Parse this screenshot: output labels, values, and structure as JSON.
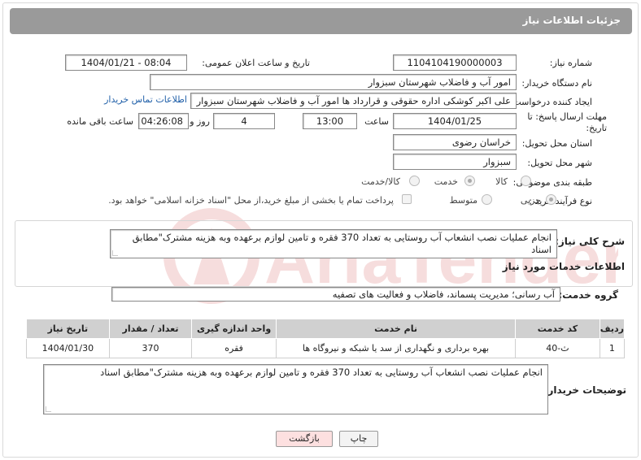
{
  "header": {
    "title": "جزئیات اطلاعات نیاز"
  },
  "form": {
    "need_number": {
      "label": "شماره نیاز:",
      "value": "1104104190000003"
    },
    "announce_datetime": {
      "label": "تاریخ و ساعت اعلان عمومی:",
      "value": "1404/01/21 - 08:04"
    },
    "buyer_org": {
      "label": "نام دستگاه خریدار:",
      "value": "امور آب و فاضلاب شهرستان سبزوار"
    },
    "requester": {
      "label": "ایجاد کننده درخواست:",
      "value": "علی اکبر کوشکی اداره حقوقی و قرارداد ها امور آب و فاضلاب شهرستان سبزوار",
      "contact_link": "اطلاعات تماس خریدار"
    },
    "deadline": {
      "label_line1": "مهلت ارسال پاسخ: تا",
      "label_line2": "تاریخ:",
      "date": "1404/01/25",
      "time_label": "ساعت",
      "time": "13:00",
      "days": "4",
      "days_label": "روز و",
      "remaining": "04:26:08",
      "remaining_label": "ساعت باقی مانده"
    },
    "province": {
      "label": "استان محل تحویل:",
      "value": "خراسان رضوی"
    },
    "city": {
      "label": "شهر محل تحویل:",
      "value": "سبزوار"
    },
    "category": {
      "label": "طبقه بندی موضوعی:",
      "options": [
        "کالا",
        "خدمت",
        "کالا/خدمت"
      ],
      "selected": "خدمت"
    },
    "process": {
      "label": "نوع فرآیند خرید :",
      "options": [
        "جزیی",
        "متوسط"
      ],
      "selected": "جزیی",
      "payment_note": "پرداخت تمام یا بخشی از مبلغ خرید،از محل \"اسناد خزانه اسلامی\" خواهد بود."
    }
  },
  "description": {
    "label": "شرح کلی نیاز:",
    "value": "انجام عملیات نصب انشعاب آب روستایی به تعداد 370 فقره و تامین لوازم برعهده وبه هزینه مشترک\"مطابق اسناد"
  },
  "services": {
    "section_title": "اطلاعات خدمات مورد نیاز",
    "group_label": "گروه خدمت:",
    "group_value": "آب رسانی؛ مدیریت پسماند، فاضلاب و فعالیت های تصفیه",
    "columns": [
      "ردیف",
      "کد خدمت",
      "نام خدمت",
      "واحد اندازه گیری",
      "تعداد / مقدار",
      "تاریخ نیاز"
    ],
    "rows": [
      [
        "1",
        "ث-40",
        "بهره برداری و نگهداری از سد یا شبکه و نیروگاه ها",
        "فقره",
        "370",
        "1404/01/30"
      ]
    ]
  },
  "buyer_notes": {
    "label": "توضیحات خریدار:",
    "value": "انجام عملیات نصب انشعاب آب روستایی به تعداد 370 فقره و تامین لوازم برعهده وبه هزینه مشترک\"مطابق اسناد"
  },
  "buttons": {
    "print": "چاپ",
    "back": "بازگشت"
  },
  "watermark": {
    "text": "AriaTender.neT",
    "icon": "aria-tender-logo-icon"
  },
  "colors": {
    "header_bg": "#9a9a9a",
    "table_header_bg": "#d0d0d0",
    "link": "#1f5fa8",
    "back_button_bg": "#fde0e0"
  }
}
